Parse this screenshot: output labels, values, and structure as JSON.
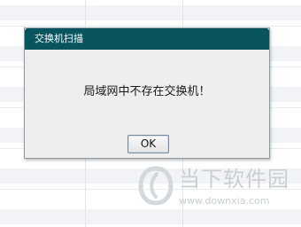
{
  "dialog": {
    "title": "交换机扫描",
    "message": "局域网中不存在交换机！",
    "ok_label": "OK"
  },
  "watermark": {
    "name": "当下软件园",
    "url": "www.downxia.com"
  },
  "colors": {
    "titlebar": "#08545f",
    "dialog_bg": "#eeeeee",
    "watermark": "#c9cfd4"
  }
}
